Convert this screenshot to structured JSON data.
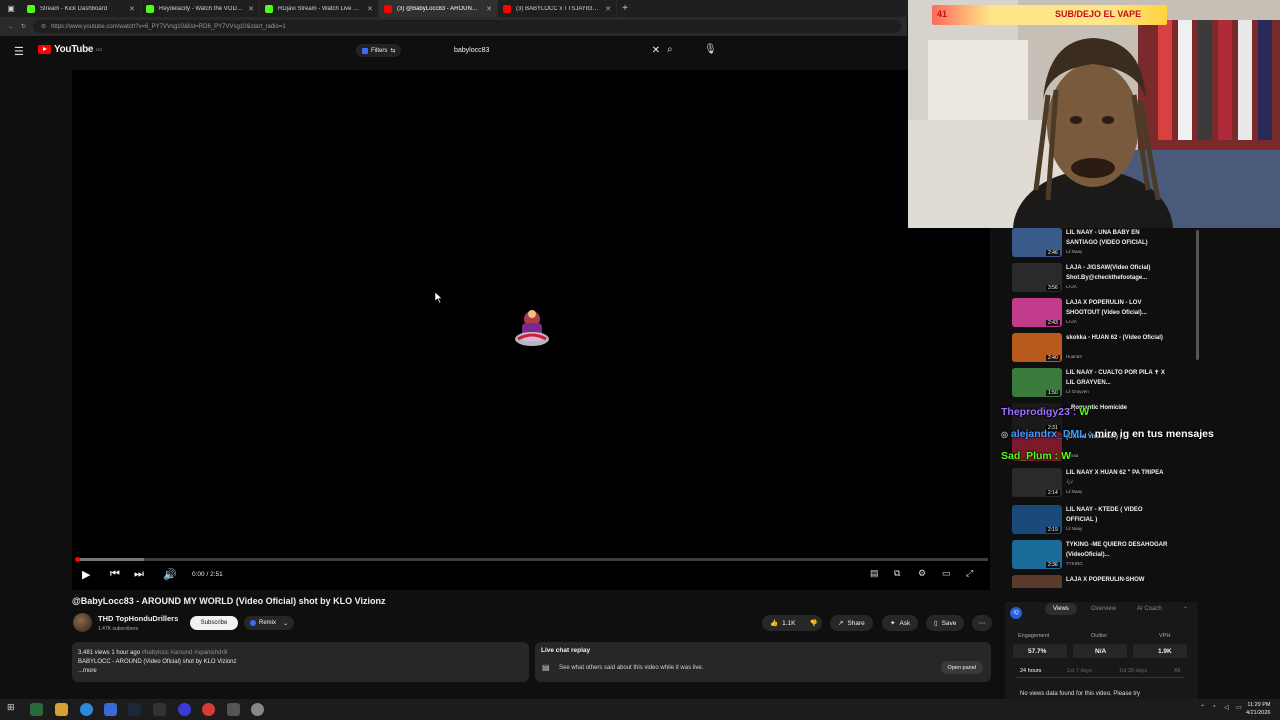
{
  "browser": {
    "tabs": [
      {
        "label": "Stream - Kick Dashboard",
        "color": "#53fc18"
      },
      {
        "label": "Reydelacity - Watch the VOD on K",
        "color": "#53fc18"
      },
      {
        "label": "RDjavi Stream - Watch Live on Ki",
        "color": "#53fc18"
      },
      {
        "label": "(3) @BabyLocc83 - AROUND MY",
        "color": "#ff0000"
      },
      {
        "label": "(3) BABYLOCC x TTSJAY83 - EVIL",
        "color": "#ff0000"
      }
    ],
    "new_tab": "+",
    "url": "https://www.youtube.com/watch?v=6_PY7VVsg10&list=RD6_PY7VVsg10&start_radio=1"
  },
  "youtube": {
    "logo_text": "YouTube",
    "logo_sup": "DO",
    "filters_label": "Filters",
    "search_value": "babylocc83",
    "player": {
      "time": "0:00 / 2:51",
      "progress_buffered": 0.075
    },
    "video": {
      "title": "@BabyLocc83 - AROUND MY WORLD (Video Oficial) shot by KLO Vizionz",
      "channel": "THD TopHonduDrillers",
      "subscribers": "1.47K subscribers",
      "subscribe_label": "Subscribe",
      "remix_label": "Remix",
      "likes": "1.1K",
      "share_label": "Share",
      "ask_label": "Ask",
      "save_label": "Save",
      "desc_stats": "3,481 views  1 hour ago",
      "desc_tags": "#babylocc #around #spanishdrill",
      "desc_text": "BABYLOCC - AROUND (Video Oficial) shot by KLO Vizionz",
      "desc_more": "...more"
    },
    "live_chat": {
      "title": "Live chat replay",
      "subtitle": "See what others said about this video while it was live.",
      "button": "Open panel"
    },
    "recommendations": [
      {
        "title": "LIL NAAY - UNA BABY EN SANTIAGO (VIDEO OFICIAL)",
        "channel": "Lil Naay",
        "duration": "2:46",
        "color": "#3a5a8a"
      },
      {
        "title": "LAJA - JIGSAW(Video Oficial) Shot.By@checkthefootage...",
        "channel": "LAJA",
        "duration": "3:56",
        "color": "#2a2a2a"
      },
      {
        "title": "LAJA X POPERULIN - LOV SHOOTOUT (Video Oficial)...",
        "channel": "LAJA",
        "duration": "2:43",
        "color": "#c23a8a"
      },
      {
        "title": "skokka - HUAN 62 - (Video Oficial)",
        "channel": "Huan62",
        "duration": "2:40",
        "color": "#b85a1a"
      },
      {
        "title": "LIL NAAY - CUALTO POR PILA ✝ X LIL GRAYVEN...",
        "channel": "Lil Grayven",
        "duration": "1:50",
        "color": "#3a7a3a"
      },
      {
        "title": "...Romantic Homicide",
        "channel": "",
        "duration": "2:31",
        "color": "#1a1a1a"
      },
      {
        "title": "(Oficial Visualizer) |...",
        "channel": "Junaa",
        "duration": "",
        "color": "#7a1a2a"
      },
      {
        "title": "LIL NAAY X HUAN 62 \" PA TRIPEA 🎶",
        "channel": "Lil Naay",
        "duration": "2:14",
        "color": "#2a2a2a"
      },
      {
        "title": "LIL NAAY - KTEDE ( VIDEO OFFICIAL )",
        "channel": "Lil Naay",
        "duration": "2:19",
        "color": "#1a4a7a"
      },
      {
        "title": "TYKING -ME QUIERO DESAHOGAR (VideoOficial)...",
        "channel": "TYKING",
        "duration": "2:36",
        "color": "#1a6a9a"
      },
      {
        "title": "LAJA X POPERULIN-SHOW",
        "channel": "",
        "duration": "",
        "color": "#5a3a2a"
      }
    ],
    "panel": {
      "tabs": [
        "Views",
        "Overview",
        "AI Coach"
      ],
      "logo": "IQ",
      "metrics": [
        {
          "label": "Engagement",
          "value": "57.7%"
        },
        {
          "label": "Outlier",
          "value": "N/A"
        },
        {
          "label": "VPH",
          "value": "1.9K"
        }
      ],
      "ranges": [
        "24 hours",
        "1st 7 days",
        "1st 28 days",
        "All"
      ],
      "no_data": "No views data found for this video. Please try"
    }
  },
  "overlay": {
    "cam_number": "41",
    "cam_banner": "SUB/DEJO EL VAPE",
    "chat": [
      {
        "user": "Theprodigy23 :",
        "emote": "W",
        "message": "",
        "color": "#a070ff"
      },
      {
        "user": "alejandrx_DML :",
        "emote": "",
        "message": "mire ig en tus mensajes",
        "color": "#3a9eff"
      },
      {
        "user": "Sad_Plum :",
        "emote": "W",
        "message": "",
        "color": "#53fc18"
      }
    ]
  },
  "taskbar": {
    "time": "11:29 PM",
    "date": "4/21/2026"
  }
}
